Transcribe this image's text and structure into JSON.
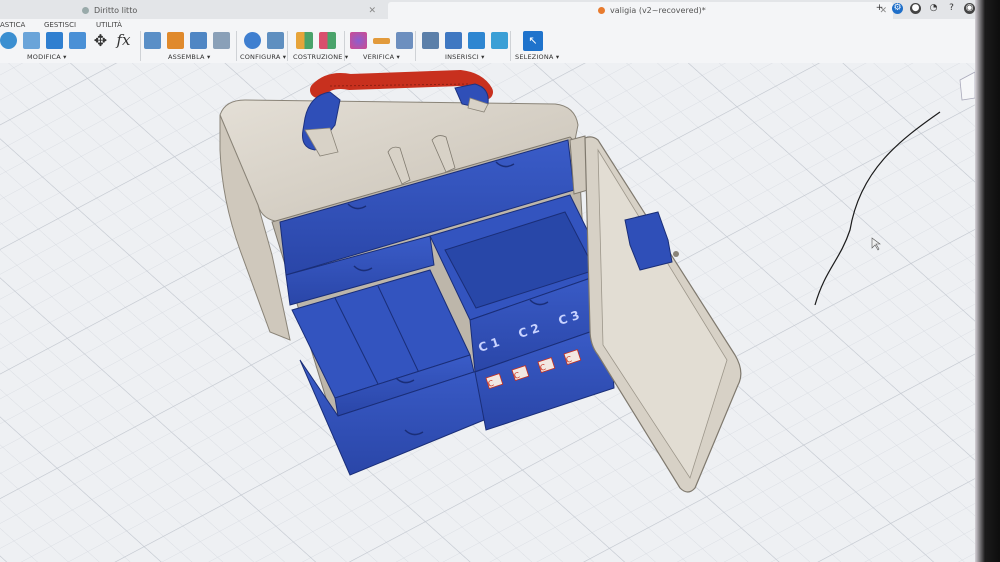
{
  "browser": {
    "tab1_title": "Diritto litto",
    "tab2_title": "valigia (v2~recovered)*"
  },
  "ribbon": {
    "subtabs": [
      "ASTICA",
      "GESTISCI",
      "UTILITÀ"
    ],
    "groups": [
      "MODIFICA ▾",
      "ASSEMBLA ▾",
      "CONFIGURA ▾",
      "COSTRUZIONE ▾",
      "VERIFICA ▾",
      "INSERISCI ▾",
      "SELEZIONA ▾"
    ],
    "fx_label": "fx"
  },
  "model": {
    "drawer_labels": [
      "C 1",
      "C 2",
      "C 3"
    ],
    "tag_text": "C"
  },
  "colors": {
    "accent_blue": "#2f4fb8",
    "shell": "#d9d3c8",
    "handle_red": "#c8301e",
    "grid_bg": "#eef0f3"
  }
}
